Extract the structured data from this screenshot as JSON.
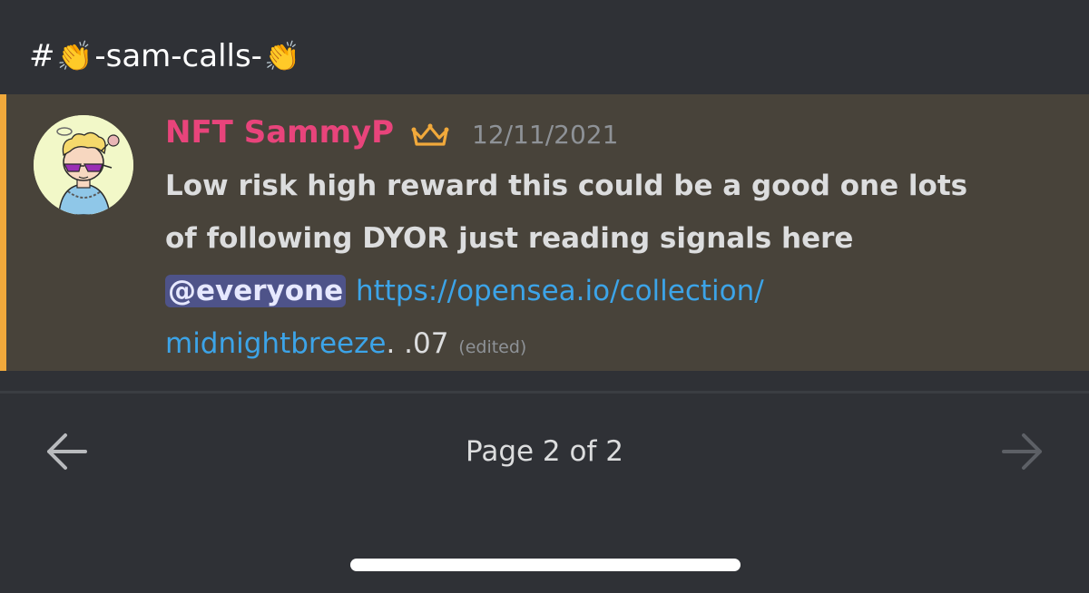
{
  "channel": {
    "prefix": "#",
    "emoji": "👏",
    "name": "-sam-calls-"
  },
  "message": {
    "author": "NFT SammyP",
    "timestamp": "12/11/2021",
    "line1": "Low risk high reward this could be a good one lots",
    "line2": "of following DYOR just reading signals here",
    "mention": "@everyone",
    "link_part1": "https://opensea.io/collection/",
    "link_part2": "midnightbreeze",
    "after_link": ". .07",
    "edited": "(edited)"
  },
  "pagination": {
    "label": "Page 2 of 2"
  },
  "colors": {
    "background": "#2f3136",
    "highlight": "#48433a",
    "mention_bar": "#f1a93b",
    "username": "#e8447b",
    "link": "#3ca4e8",
    "mention_bg": "#4e5389",
    "crown": "#f1a93b"
  },
  "icons": {
    "crown": "crown-icon",
    "prev": "arrow-left-icon",
    "next": "arrow-right-icon"
  }
}
